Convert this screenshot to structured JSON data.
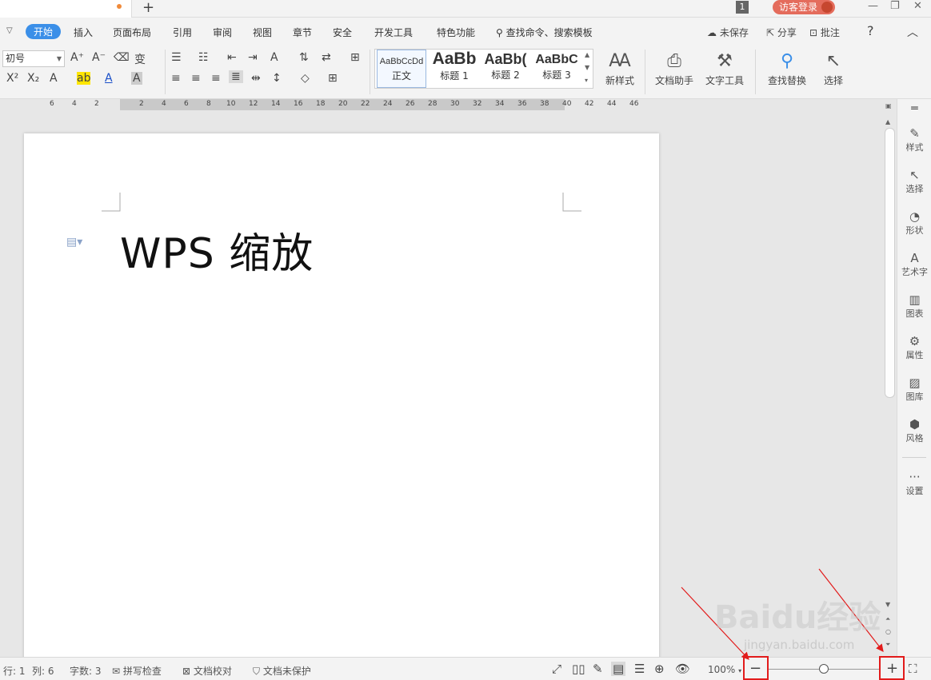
{
  "titlebar": {
    "new_tab": "+",
    "badge": "1",
    "login": "访客登录",
    "minimize": "—",
    "restore": "❐",
    "close": "✕"
  },
  "menu": {
    "tabs": [
      "开始",
      "插入",
      "页面布局",
      "引用",
      "审阅",
      "视图",
      "章节",
      "安全",
      "开发工具",
      "特色功能"
    ],
    "search": "查找命令、搜索模板",
    "unsaved": "未保存",
    "share": "分享",
    "comment": "批注",
    "help": "?"
  },
  "ribbon": {
    "font_size": "初号",
    "styles": [
      {
        "preview": "AaBbCcDd",
        "label": "正文"
      },
      {
        "preview": "AaBb",
        "label": "标题 1"
      },
      {
        "preview": "AaBb(",
        "label": "标题 2"
      },
      {
        "preview": "AaBbC",
        "label": "标题 3"
      }
    ],
    "new_style": "新样式",
    "doc_assistant": "文档助手",
    "text_tools": "文字工具",
    "find_replace": "查找替换",
    "select": "选择"
  },
  "ruler": {
    "ticks": [
      "6",
      "4",
      "2",
      "",
      "2",
      "4",
      "6",
      "8",
      "10",
      "12",
      "14",
      "16",
      "18",
      "20",
      "22",
      "24",
      "26",
      "28",
      "30",
      "32",
      "34",
      "36",
      "38",
      "40",
      "42",
      "44",
      "46"
    ]
  },
  "document": {
    "text": "WPS 缩放"
  },
  "right_panel": {
    "items": [
      "样式",
      "选择",
      "形状",
      "艺术字",
      "图表",
      "属性",
      "图库",
      "风格",
      "设置"
    ]
  },
  "status": {
    "row": "行: 1",
    "col": "列: 6",
    "word_count": "字数: 3",
    "spell_check": "拼写检查",
    "doc_proof": "文档校对",
    "unprotected": "文档未保护",
    "zoom": "100%",
    "zoom_level": 0.5
  },
  "watermark": {
    "text": "Baidu经验",
    "sub": "jingyan.baidu.com"
  },
  "colors": {
    "accent": "#3b8fe8",
    "highlight": "#e21b1b",
    "login": "#e46c5c"
  }
}
